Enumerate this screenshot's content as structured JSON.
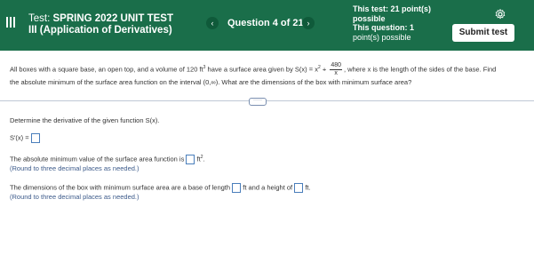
{
  "header": {
    "test_prefix": "Test: ",
    "test_title_line1": "SPRING 2022 UNIT TEST",
    "test_title_line2": "III (Application of Derivatives)",
    "question_counter": "Question 4 of 21",
    "prev_arrow": "‹",
    "next_arrow": "›",
    "test_points": "This test: 21 point(s) possible",
    "question_points_label": "This question: 1",
    "question_points": "point(s) possible",
    "submit_label": "Submit test"
  },
  "problem": {
    "part1": "All boxes with a square base, an open top, and a volume of 120 ft",
    "part2": " have a surface area given by S(x) = x",
    "part3": " + ",
    "frac_num": "480",
    "frac_den": "x",
    "part4": ", where x is the length of the sides of the base. Find",
    "line2": "the absolute minimum of the surface area function on the interval (0,∞). What are the dimensions of the box with minimum surface area?",
    "sup3": "3",
    "sup2": "2"
  },
  "more_button": "·····",
  "steps": {
    "derivative_prompt": "Determine the derivative of the given function S(x).",
    "derivative_label": "S'(x) =",
    "min_value_prefix": "The absolute minimum value of the surface area function is",
    "min_value_unit": "ft",
    "min_value_unit_sup": "2",
    "min_value_suffix": ".",
    "round_hint_1": "(Round to three decimal places as needed.)",
    "dims_prefix": "The dimensions of the box with minimum surface area are a base of length",
    "dims_mid": "ft and a height of",
    "dims_unit": "ft.",
    "round_hint_2": "(Round to three decimal places as needed.)"
  },
  "colors": {
    "header_bg": "#1a6e4a",
    "input_border": "#4a7ebb"
  }
}
